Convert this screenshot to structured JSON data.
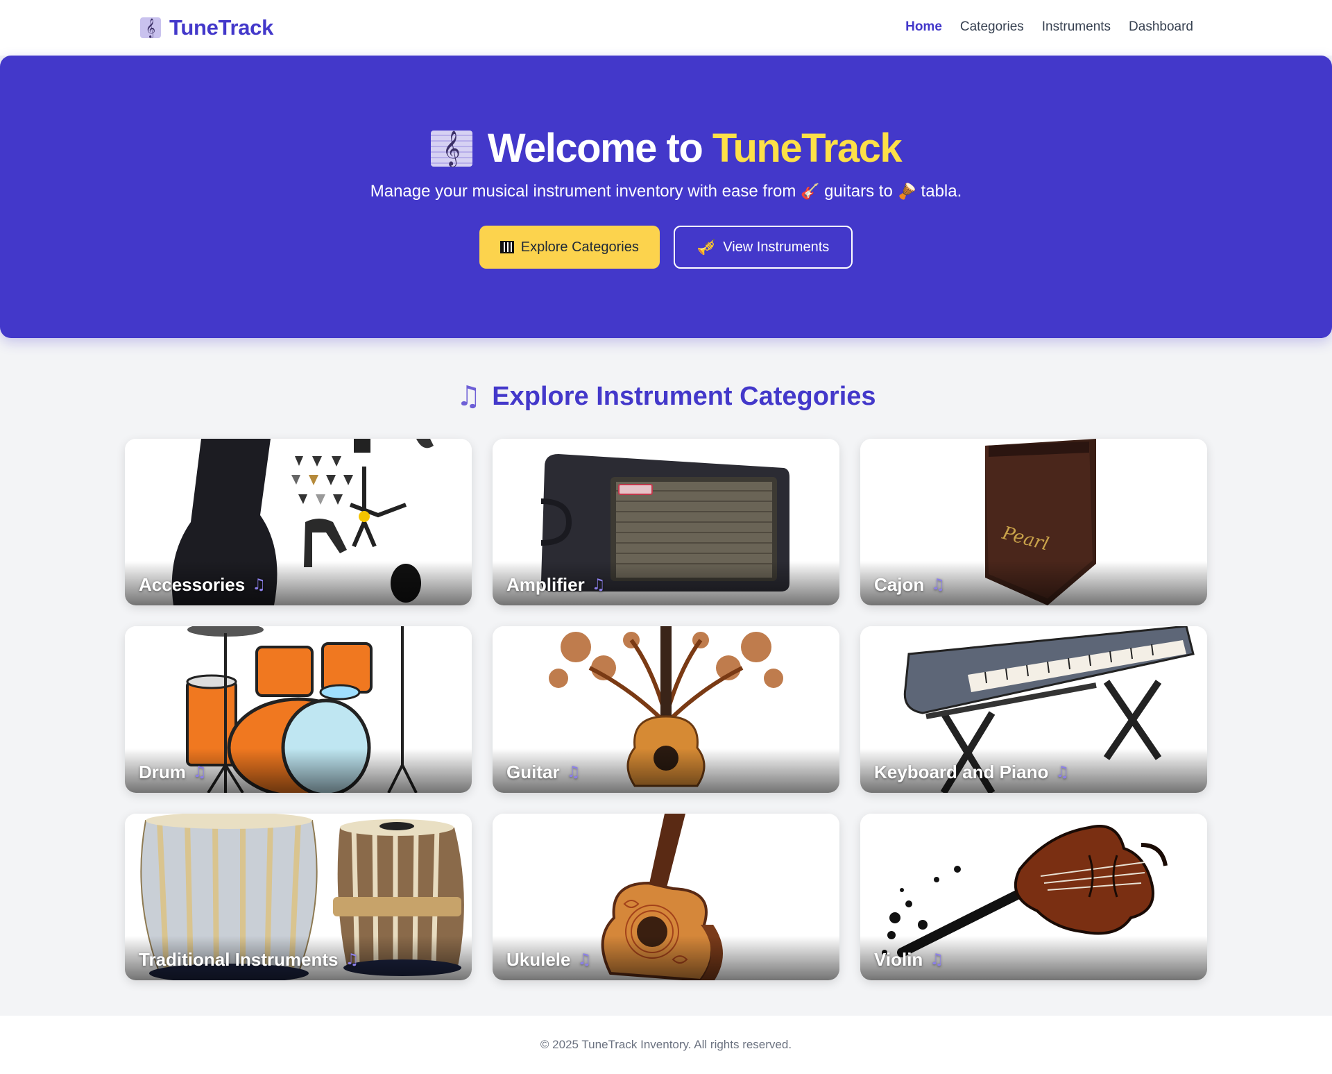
{
  "brand": {
    "name": "TuneTrack",
    "icon": "treble-clef-icon"
  },
  "nav": {
    "links": [
      {
        "label": "Home",
        "active": true
      },
      {
        "label": "Categories",
        "active": false
      },
      {
        "label": "Instruments",
        "active": false
      },
      {
        "label": "Dashboard",
        "active": false
      }
    ]
  },
  "hero": {
    "title_prefix": "Welcome to",
    "title_accent": "TuneTrack",
    "subtitle_part1": "Manage your musical instrument inventory with ease from",
    "subtitle_emoji1": "🎸",
    "subtitle_part2": "guitars to",
    "subtitle_emoji2": "🪘",
    "subtitle_part3": "tabla.",
    "primary_button": "Explore Categories",
    "secondary_button": "View Instruments",
    "accent_color": "#fde047",
    "background_color": "#4338ca"
  },
  "section": {
    "title": "Explore Instrument Categories",
    "icon": "music-note-icon"
  },
  "categories": [
    {
      "label": "Accessories"
    },
    {
      "label": "Amplifier"
    },
    {
      "label": "Cajon"
    },
    {
      "label": "Drum"
    },
    {
      "label": "Guitar"
    },
    {
      "label": "Keyboard and Piano"
    },
    {
      "label": "Traditional Instruments"
    },
    {
      "label": "Ukulele"
    },
    {
      "label": "Violin"
    }
  ],
  "footer": {
    "text": "© 2025 TuneTrack Inventory. All rights reserved."
  }
}
